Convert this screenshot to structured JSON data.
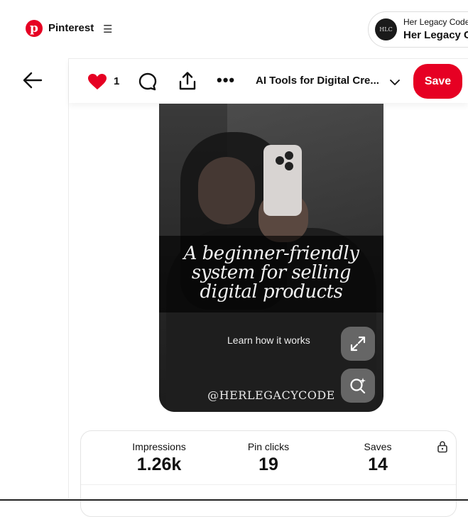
{
  "header": {
    "brand": "Pinterest",
    "menu_icon": "hamburger-icon",
    "account": {
      "line1": "Her Legacy Code",
      "line2": "Her Legacy C",
      "avatar_text": "HLC"
    }
  },
  "actionbar": {
    "reaction_count": "1",
    "board_name": "AI Tools for Digital Cre...",
    "save_label": "Save",
    "more_glyph": "•••"
  },
  "pin": {
    "headline_1": "A beginner-friendly",
    "headline_2": "system for selling",
    "headline_3": "digital products",
    "cta": "Learn how it works",
    "handle": "@HERLEGACYCODE"
  },
  "stats": [
    {
      "label": "Impressions",
      "value": "1.26k"
    },
    {
      "label": "Pin clicks",
      "value": "19"
    },
    {
      "label": "Saves",
      "value": "14"
    }
  ],
  "colors": {
    "brand_red": "#e60023",
    "text": "#111111"
  }
}
